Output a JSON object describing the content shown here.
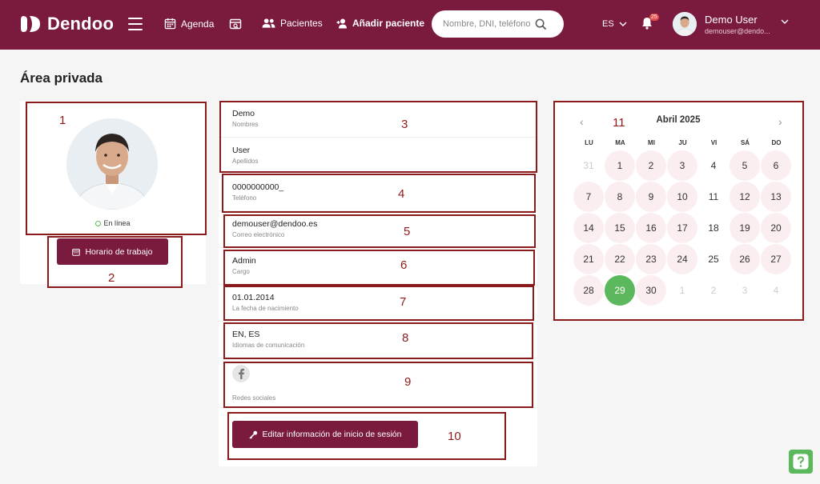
{
  "header": {
    "logo_text": "Dendoo",
    "nav": {
      "agenda": "Agenda",
      "pacientes": "Pacientes",
      "add_patient": "Añadir paciente"
    },
    "search_placeholder": "Nombre, DNI, teléfono",
    "language": "ES",
    "notifications_count": "25",
    "user_name": "Demo User",
    "user_email": "demouser@dendo..."
  },
  "page_title": "Área privada",
  "profile": {
    "status": "En línea",
    "schedule_button": "Horario de trabajo"
  },
  "fields": [
    {
      "value": "Demo",
      "label": "Nombres"
    },
    {
      "value": "User",
      "label": "Apellidos"
    },
    {
      "value": "0000000000_",
      "label": "Teléfono"
    },
    {
      "value": "demouser@dendoo.es",
      "label": "Correo electrónico"
    },
    {
      "value": "Admin",
      "label": "Cargo"
    },
    {
      "value": "01.01.2014",
      "label": "La fecha de nacimiento"
    },
    {
      "value": "EN, ES",
      "label": "Idiomas de comunicación"
    }
  ],
  "social": {
    "label": "Redes sociales",
    "icon": "facebook-icon"
  },
  "edit_login_button": "Editar información de inicio de sesión",
  "calendar": {
    "title": "Abril 2025",
    "weekdays": [
      "LU",
      "MA",
      "MI",
      "JU",
      "VI",
      "SÁ",
      "DO"
    ],
    "days": [
      {
        "n": "31",
        "state": "muted"
      },
      {
        "n": "1",
        "state": "avail"
      },
      {
        "n": "2",
        "state": "avail"
      },
      {
        "n": "3",
        "state": "avail"
      },
      {
        "n": "4",
        "state": "plain"
      },
      {
        "n": "5",
        "state": "avail"
      },
      {
        "n": "6",
        "state": "avail"
      },
      {
        "n": "7",
        "state": "avail"
      },
      {
        "n": "8",
        "state": "avail"
      },
      {
        "n": "9",
        "state": "avail"
      },
      {
        "n": "10",
        "state": "avail"
      },
      {
        "n": "11",
        "state": "plain"
      },
      {
        "n": "12",
        "state": "avail"
      },
      {
        "n": "13",
        "state": "avail"
      },
      {
        "n": "14",
        "state": "avail"
      },
      {
        "n": "15",
        "state": "avail"
      },
      {
        "n": "16",
        "state": "avail"
      },
      {
        "n": "17",
        "state": "avail"
      },
      {
        "n": "18",
        "state": "plain"
      },
      {
        "n": "19",
        "state": "avail"
      },
      {
        "n": "20",
        "state": "avail"
      },
      {
        "n": "21",
        "state": "avail"
      },
      {
        "n": "22",
        "state": "avail"
      },
      {
        "n": "23",
        "state": "avail"
      },
      {
        "n": "24",
        "state": "avail"
      },
      {
        "n": "25",
        "state": "plain"
      },
      {
        "n": "26",
        "state": "avail"
      },
      {
        "n": "27",
        "state": "avail"
      },
      {
        "n": "28",
        "state": "avail"
      },
      {
        "n": "29",
        "state": "today"
      },
      {
        "n": "30",
        "state": "avail"
      },
      {
        "n": "1",
        "state": "muted"
      },
      {
        "n": "2",
        "state": "muted"
      },
      {
        "n": "3",
        "state": "muted"
      },
      {
        "n": "4",
        "state": "muted"
      }
    ]
  },
  "annotations": [
    "1",
    "2",
    "3",
    "4",
    "5",
    "6",
    "7",
    "8",
    "9",
    "10",
    "11"
  ],
  "colors": {
    "brand": "#7a1a3e",
    "available_day": "#fbeef0",
    "today": "#5cb85c",
    "annotation": "#8b1a1a"
  }
}
